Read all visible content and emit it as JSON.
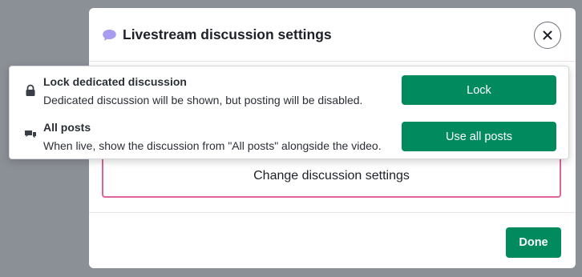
{
  "modal": {
    "title": "Livestream discussion settings",
    "title_icon": "speech-bubble-icon",
    "close_icon": "close-icon",
    "change_settings_label": "Change discussion settings",
    "done_label": "Done"
  },
  "popover": {
    "options": [
      {
        "icon": "lock-icon",
        "title": "Lock dedicated discussion",
        "description": "Dedicated discussion will be shown, but posting will be disabled.",
        "button_label": "Lock"
      },
      {
        "icon": "chat-bubbles-icon",
        "title": "All posts",
        "description": "When live, show the discussion from \"All posts\" alongside the video.",
        "button_label": "Use all posts"
      }
    ]
  },
  "colors": {
    "primary_button": "#008a5e",
    "accent_border": "#e0629a",
    "backdrop": "#8b8f96",
    "title_icon": "#a79cf0"
  }
}
